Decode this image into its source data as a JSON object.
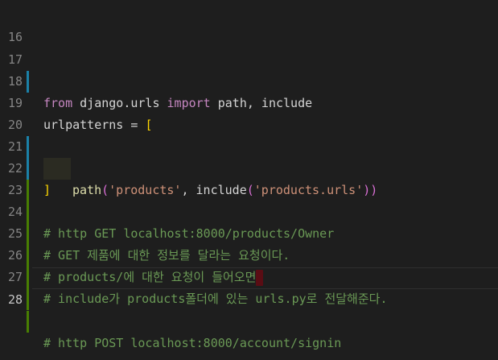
{
  "colors": {
    "background": "#1e1e1e",
    "keyword": "#c586c0",
    "string": "#ce9178",
    "comment": "#6a9955",
    "gutter_modified": "#1b81a8",
    "gutter_added": "#487e02"
  },
  "lines": [
    {
      "number": "16"
    },
    {
      "number": "17",
      "tokens": [
        "from",
        " django.urls ",
        "import",
        " path, include"
      ]
    },
    {
      "number": "18"
    },
    {
      "number": "19",
      "tokens": [
        "urlpatterns = ",
        "["
      ]
    },
    {
      "number": "20",
      "tokens": [
        "path",
        "(",
        "'products'",
        ", include",
        "(",
        "'products.urls'",
        ")",
        ")"
      ]
    },
    {
      "number": "21",
      "tokens": [
        "]"
      ]
    },
    {
      "number": "22"
    },
    {
      "number": "23",
      "comment": "# http GET localhost:8000/products/Owner"
    },
    {
      "number": "24",
      "comment": "# GET 제품에 대한 정보를 달라는 요청이다."
    },
    {
      "number": "25",
      "comment": "# products/에 대한 요청이 들어오면"
    },
    {
      "number": "26",
      "comment": "# include가 products폴더에 있는 urls.py로 전달해준다."
    },
    {
      "number": "27"
    },
    {
      "number": "28",
      "comment": "# http POST localhost:8000/account/signin"
    }
  ]
}
